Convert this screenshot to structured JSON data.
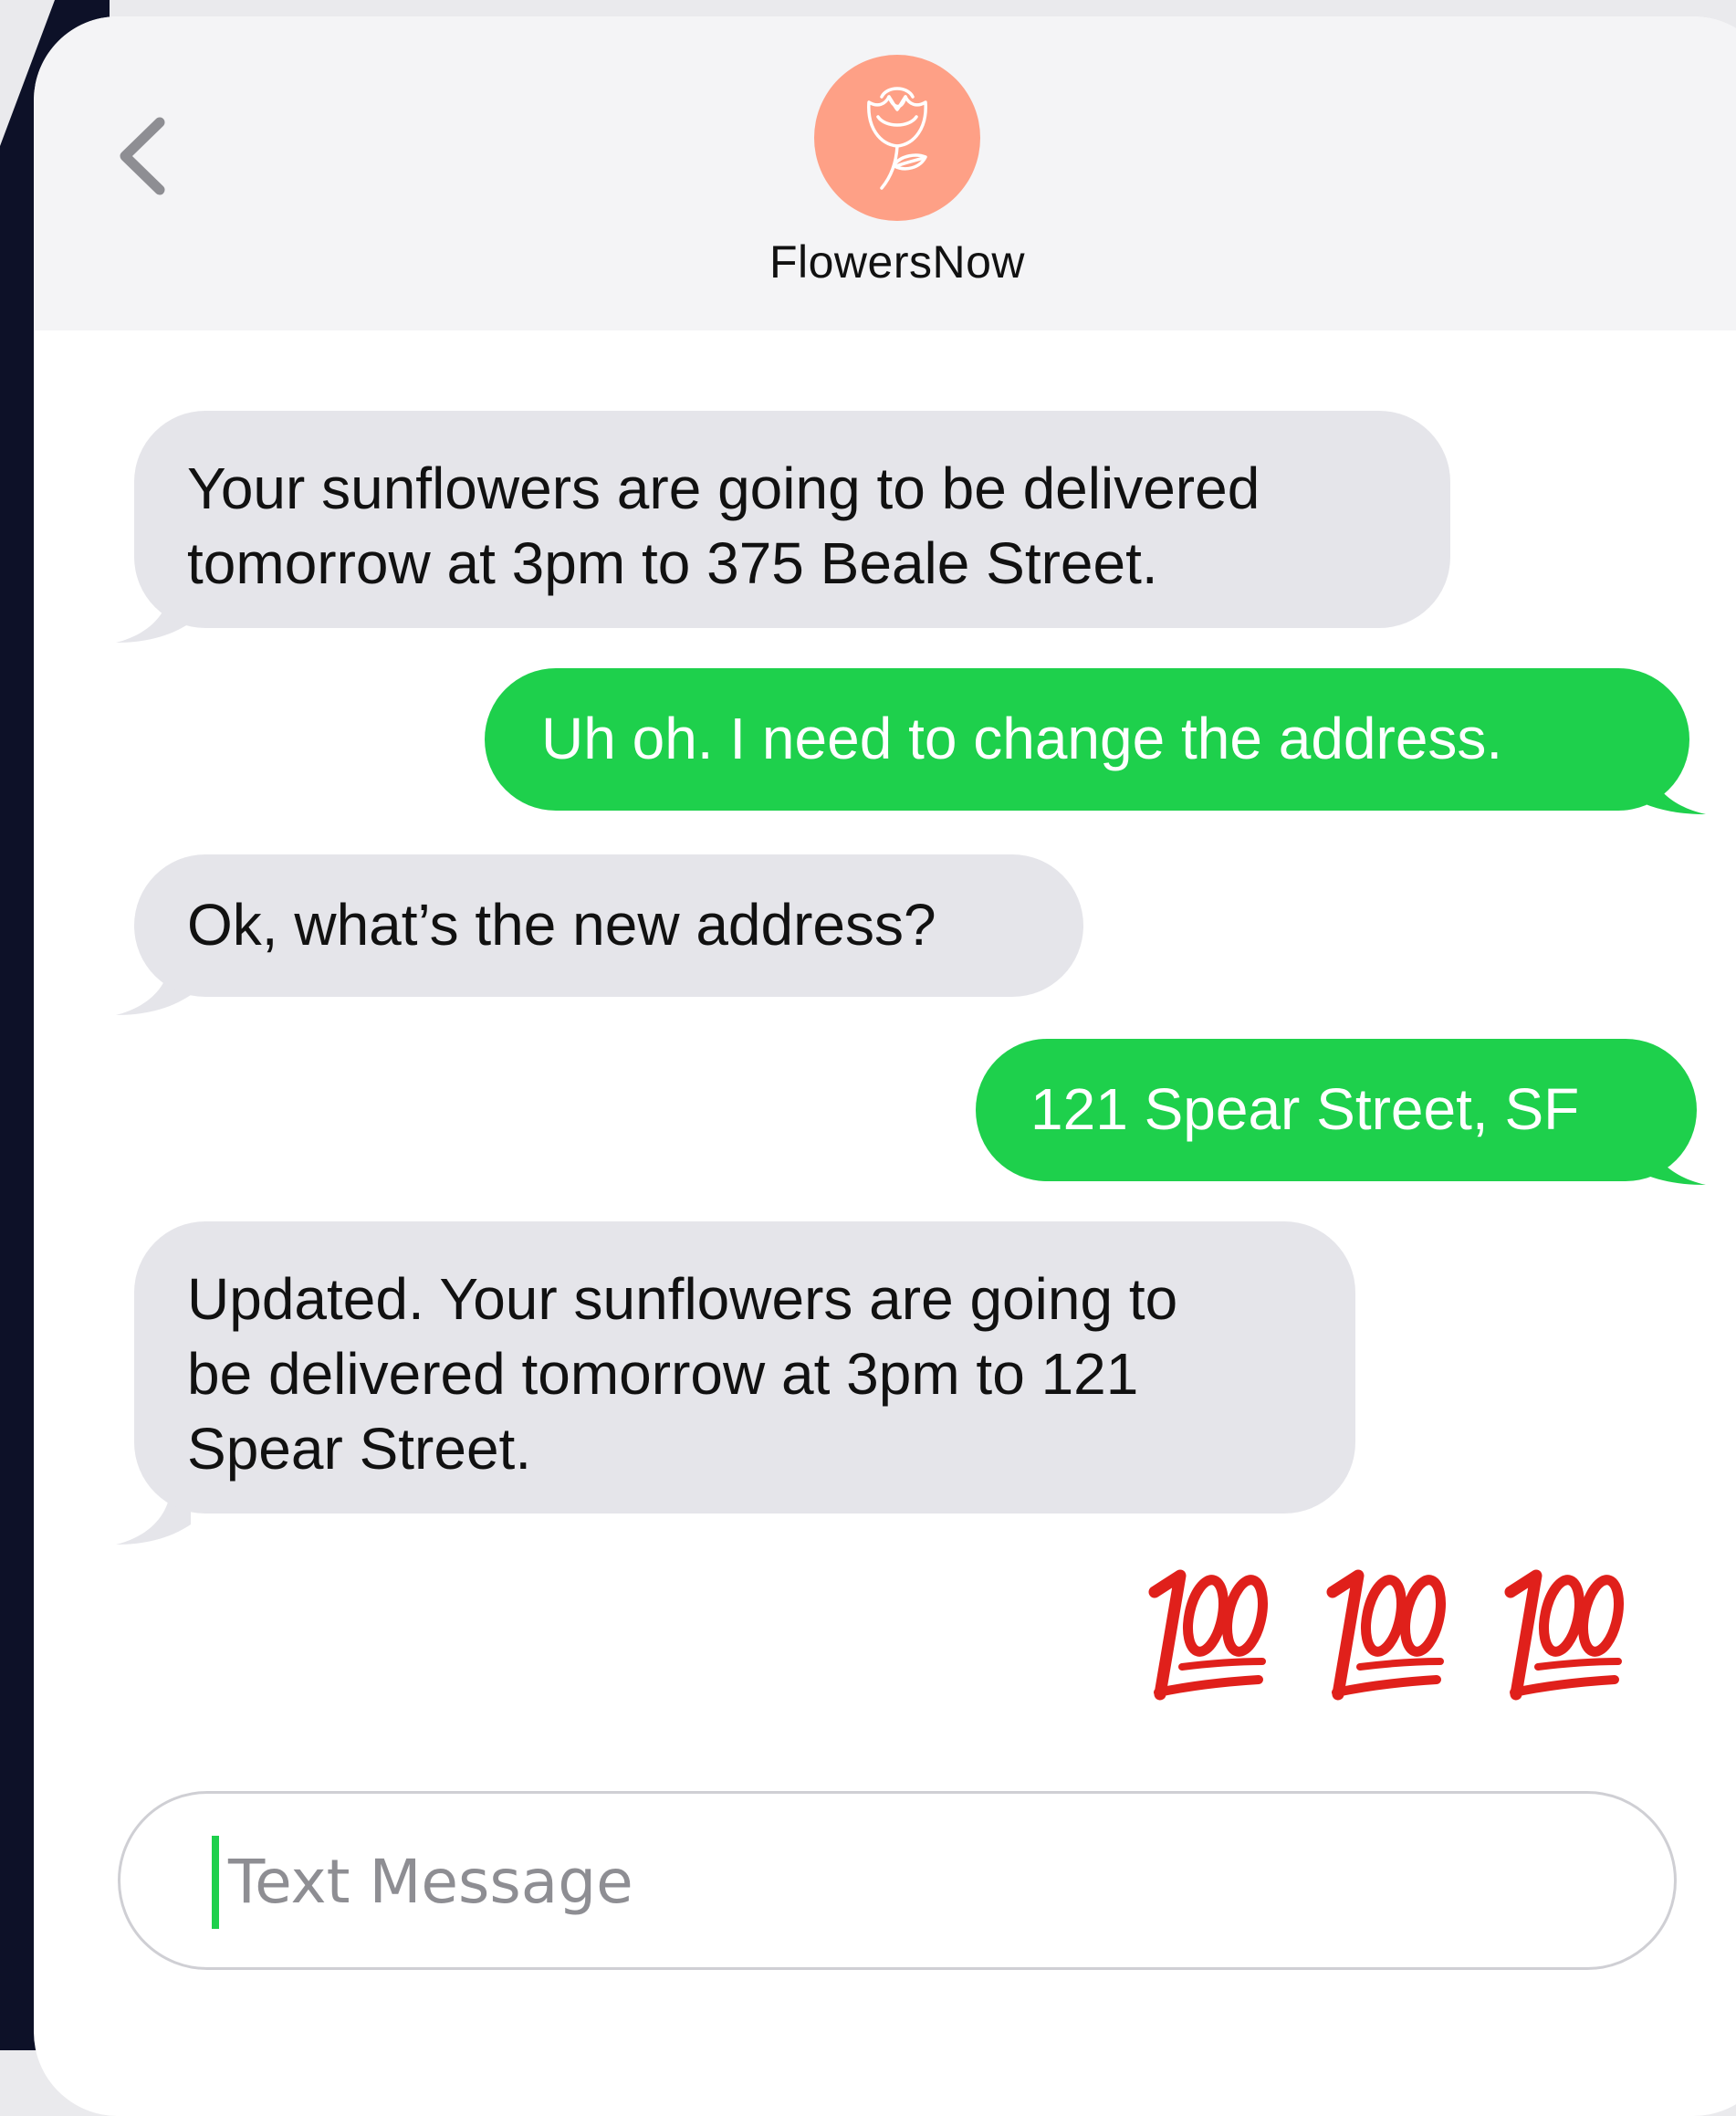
{
  "header": {
    "contact_name": "FlowersNow",
    "back_icon": "chevron-left-icon",
    "avatar_icon": "rose-icon",
    "avatar_color": "#fea086"
  },
  "messages": [
    {
      "direction": "incoming",
      "lines": [
        "Your sunflowers are going to be delivered",
        "tomorrow at 3pm to 375 Beale Street."
      ]
    },
    {
      "direction": "outgoing",
      "lines": [
        "Uh oh. I need to change the address."
      ]
    },
    {
      "direction": "incoming",
      "lines": [
        "Ok, what’s the new address?"
      ]
    },
    {
      "direction": "outgoing",
      "lines": [
        "121 Spear Street, SF"
      ]
    },
    {
      "direction": "incoming",
      "lines": [
        "Updated. Your sunflowers are going to",
        "be delivered tomorrow at 3pm to 121",
        "Spear Street."
      ]
    },
    {
      "direction": "outgoing",
      "emoji": "hundred-points-icon",
      "count": 3
    }
  ],
  "composer": {
    "placeholder": "Text Message"
  },
  "colors": {
    "incoming_bubble": "#e5e5ea",
    "outgoing_bubble": "#1ed04c",
    "device_edge": "#0d1128",
    "emoji_red": "#e0201b"
  }
}
